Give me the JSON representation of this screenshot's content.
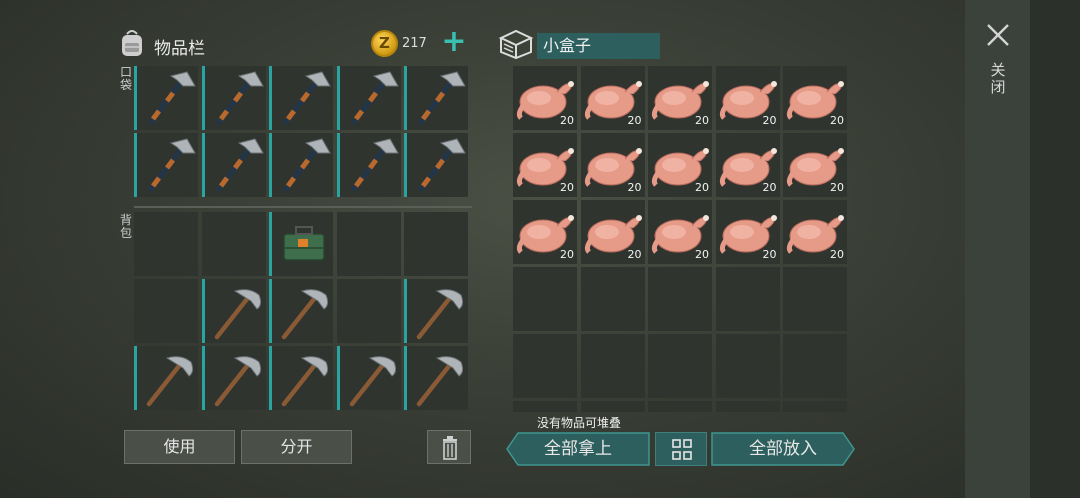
{
  "inventory": {
    "title": "物品栏",
    "coin_symbol": "Z",
    "coins": "217",
    "add_button": "+",
    "pocket_label": "口袋",
    "backpack_label": "背包",
    "pocket": [
      "hatchet",
      "hatchet",
      "hatchet",
      "hatchet",
      "hatchet",
      "hatchet",
      "hatchet",
      "hatchet",
      "hatchet",
      "hatchet"
    ],
    "backpack": [
      "",
      "",
      "toolbox",
      "",
      "",
      "",
      "pickaxe",
      "pickaxe",
      "",
      "pickaxe",
      "pickaxe",
      "pickaxe",
      "pickaxe",
      "pickaxe",
      "pickaxe"
    ],
    "use_button": "使用",
    "split_button": "分开",
    "trash_icon": "trash-icon"
  },
  "box": {
    "name": "小盒子",
    "items": [
      {
        "item": "raw-chicken",
        "qty": "20"
      },
      {
        "item": "raw-chicken",
        "qty": "20"
      },
      {
        "item": "raw-chicken",
        "qty": "20"
      },
      {
        "item": "raw-chicken",
        "qty": "20"
      },
      {
        "item": "raw-chicken",
        "qty": "20"
      },
      {
        "item": "raw-chicken",
        "qty": "20"
      },
      {
        "item": "raw-chicken",
        "qty": "20"
      },
      {
        "item": "raw-chicken",
        "qty": "20"
      },
      {
        "item": "raw-chicken",
        "qty": "20"
      },
      {
        "item": "raw-chicken",
        "qty": "20"
      },
      {
        "item": "raw-chicken",
        "qty": "20"
      },
      {
        "item": "raw-chicken",
        "qty": "20"
      },
      {
        "item": "raw-chicken",
        "qty": "20"
      },
      {
        "item": "raw-chicken",
        "qty": "20"
      },
      {
        "item": "raw-chicken",
        "qty": "20"
      },
      null,
      null,
      null,
      null,
      null,
      null,
      null,
      null,
      null,
      null,
      null,
      null,
      null,
      null,
      null
    ],
    "no_stack_text": "没有物品可堆叠",
    "take_all_button": "全部拿上",
    "put_all_button": "全部放入"
  },
  "close_label": "关闭",
  "colors": {
    "accent": "#2aa4a0",
    "accent_dark": "#2c5f5d",
    "coin": "#e0a91c",
    "chicken": "#e69a88"
  }
}
